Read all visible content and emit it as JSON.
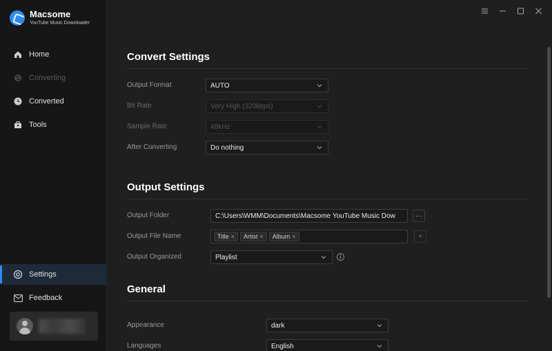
{
  "app": {
    "name": "Macsome",
    "subtitle": "YouTube Music Downloader"
  },
  "sidebar": {
    "items": [
      {
        "label": "Home",
        "icon": "home-icon",
        "state": "normal"
      },
      {
        "label": "Converting",
        "icon": "sync-icon",
        "state": "disabled"
      },
      {
        "label": "Converted",
        "icon": "clock-icon",
        "state": "normal"
      },
      {
        "label": "Tools",
        "icon": "toolbox-icon",
        "state": "normal"
      },
      {
        "label": "Settings",
        "icon": "gear-icon",
        "state": "active"
      },
      {
        "label": "Feedback",
        "icon": "mail-icon",
        "state": "normal"
      }
    ]
  },
  "window_controls": [
    "menu-icon",
    "minimize-icon",
    "maximize-icon",
    "close-icon"
  ],
  "convert_settings": {
    "title": "Convert Settings",
    "output_format": {
      "label": "Output Format",
      "value": "AUTO"
    },
    "bit_rate": {
      "label": "Bit Rate",
      "value": "Very High (320kbps)"
    },
    "sample_rate": {
      "label": "Sample Rate",
      "value": "48kHz"
    },
    "after_converting": {
      "label": "After Converting",
      "value": "Do nothing"
    }
  },
  "output_settings": {
    "title": "Output Settings",
    "output_folder": {
      "label": "Output Folder",
      "value": "C:\\Users\\WMM\\Documents\\Macsome YouTube Music Dow",
      "button": "···"
    },
    "output_file_name": {
      "label": "Output File Name",
      "tags": [
        "Title",
        "Artist",
        "Album"
      ],
      "button": "+"
    },
    "output_organized": {
      "label": "Output Organized",
      "value": "Playlist"
    }
  },
  "general": {
    "title": "General",
    "appearance": {
      "label": "Appearance",
      "value": "dark"
    },
    "languages": {
      "label": "Languages",
      "value": "English"
    }
  },
  "colors": {
    "accent": "#2e8cf5",
    "background": "#1f1f1f",
    "sidebar": "#161616"
  }
}
